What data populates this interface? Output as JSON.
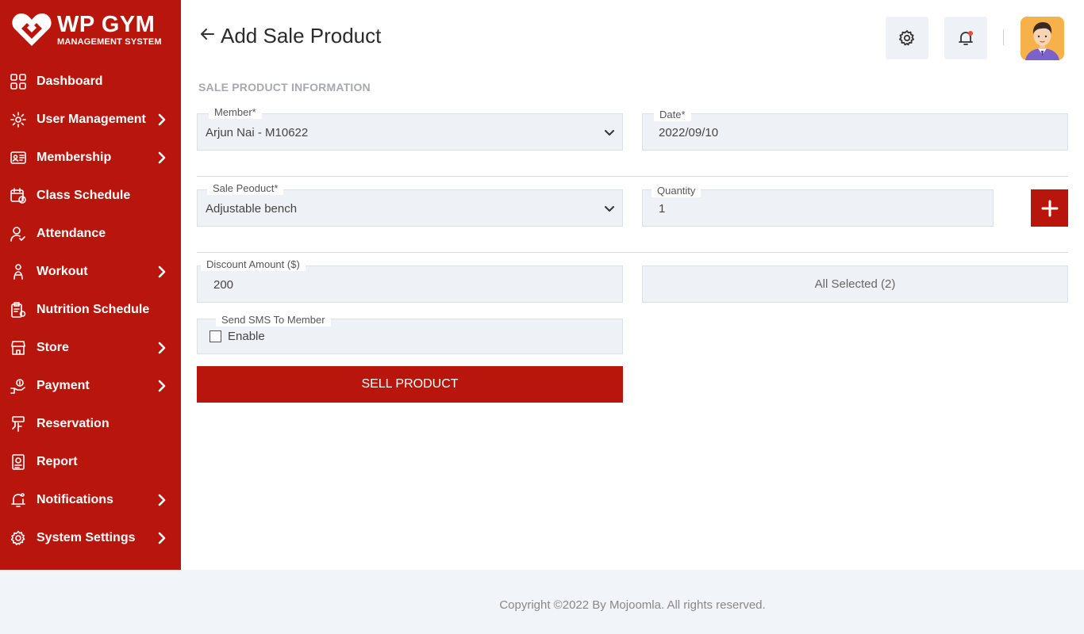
{
  "brand": {
    "title": "WP GYM",
    "subtitle": "MANAGEMENT SYSTEM"
  },
  "sidebar": {
    "items": [
      {
        "label": "Dashboard",
        "icon": "dashboard-icon",
        "has_submenu": false
      },
      {
        "label": "User Management",
        "icon": "users-gear-icon",
        "has_submenu": true
      },
      {
        "label": "Membership",
        "icon": "membership-card-icon",
        "has_submenu": true
      },
      {
        "label": "Class Schedule",
        "icon": "calendar-icon",
        "has_submenu": false
      },
      {
        "label": "Attendance",
        "icon": "user-check-icon",
        "has_submenu": false
      },
      {
        "label": "Workout",
        "icon": "workout-icon",
        "has_submenu": true
      },
      {
        "label": "Nutrition Schedule",
        "icon": "nutrition-icon",
        "has_submenu": false
      },
      {
        "label": "Store",
        "icon": "store-icon",
        "has_submenu": true
      },
      {
        "label": "Payment",
        "icon": "payment-icon",
        "has_submenu": true
      },
      {
        "label": "Reservation",
        "icon": "reservation-icon",
        "has_submenu": false
      },
      {
        "label": "Report",
        "icon": "report-icon",
        "has_submenu": false
      },
      {
        "label": "Notifications",
        "icon": "bell-icon",
        "has_submenu": true
      },
      {
        "label": "System Settings",
        "icon": "gear-icon",
        "has_submenu": true
      }
    ]
  },
  "header": {
    "title": "Add Sale Product"
  },
  "section": {
    "title": "SALE PRODUCT INFORMATION"
  },
  "form": {
    "member": {
      "label": "Member*",
      "value": "Arjun Nai - M10622"
    },
    "date": {
      "label": "Date*",
      "value": "2022/09/10"
    },
    "sale_product": {
      "label": "Sale Peoduct*",
      "value": "Adjustable bench"
    },
    "quantity": {
      "label": "Quantity",
      "value": "1"
    },
    "discount": {
      "label": "Discount Amount ($)",
      "value": "200"
    },
    "tax_select": {
      "value": "All Selected (2)"
    },
    "sms": {
      "label": "Send SMS To Member",
      "option": "Enable",
      "checked": false
    },
    "submit_label": "SELL PRODUCT"
  },
  "footer": {
    "text": "Copyright ©2022 By Mojoomla. All rights reserved."
  },
  "colors": {
    "brand": "#b8160d",
    "field_bg": "#eef2f7",
    "footer_bg": "#f1f4f8"
  }
}
